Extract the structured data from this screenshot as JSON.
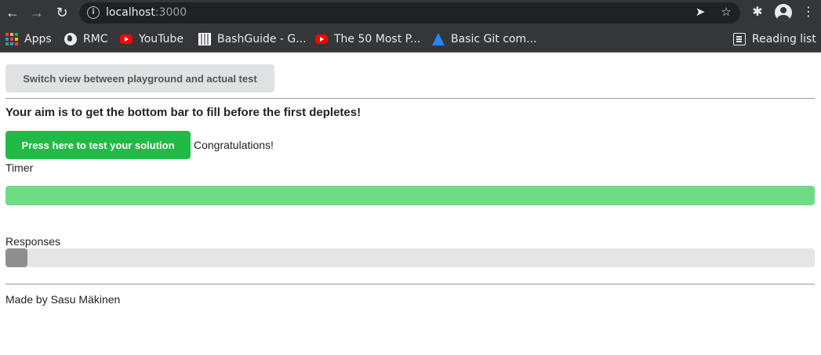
{
  "browser": {
    "url_host": "localhost",
    "url_port": ":3000",
    "bookmarks": [
      {
        "label": "Apps",
        "icon": "apps-grid-icon"
      },
      {
        "label": "RMC",
        "icon": "globe-icon"
      },
      {
        "label": "YouTube",
        "icon": "youtube-icon"
      },
      {
        "label": "BashGuide - G...",
        "icon": "qr-favicon-icon"
      },
      {
        "label": "The 50 Most P...",
        "icon": "youtube-icon"
      },
      {
        "label": "Basic Git com...",
        "icon": "atlassian-icon"
      }
    ],
    "reading_list": "Reading list"
  },
  "page": {
    "switch_button": "Switch view between playground and actual test",
    "aim_text": "Your aim is to get the bottom bar to fill before the first depletes!",
    "test_button": "Press here to test your solution",
    "result_text": "Congratulations!",
    "timer_label": "Timer",
    "timer_fill_fraction": 1.0,
    "responses_label": "Responses",
    "responses_fill_fraction": 0.027,
    "footer": "Made by Sasu Mäkinen"
  },
  "colors": {
    "primary_button": "#21ba45",
    "secondary_button": "#e0e1e2",
    "timer_bar": "#6ddc85",
    "responses_bar": "#8e8e8e",
    "track": "#e5e5e5"
  }
}
